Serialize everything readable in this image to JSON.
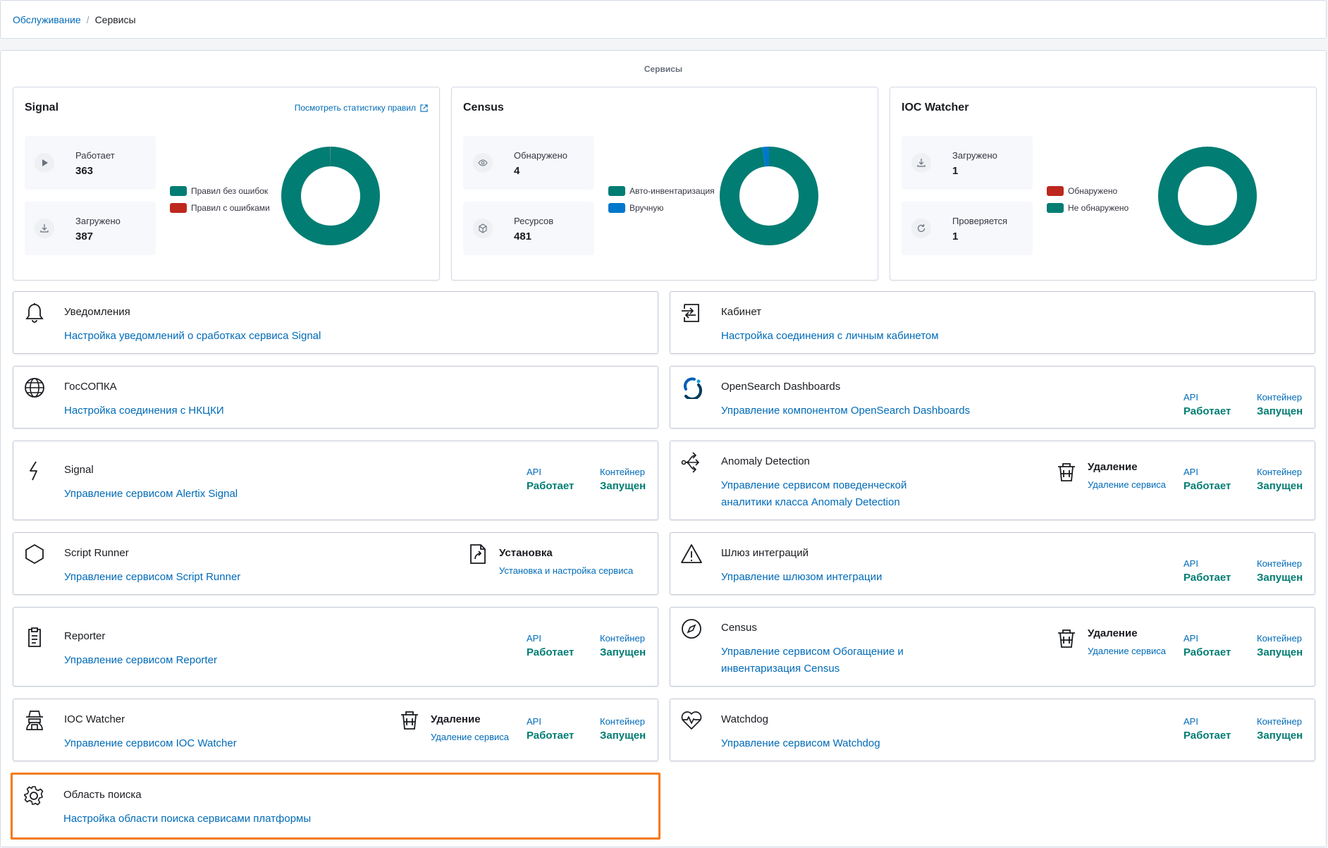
{
  "breadcrumb": {
    "parent": "Обслуживание",
    "separator": "/",
    "current": "Сервисы"
  },
  "panel_title": "Сервисы",
  "stat_cards": {
    "signal": {
      "title": "Signal",
      "link": "Посмотреть статистику правил",
      "metric1": {
        "label": "Работает",
        "value": "363",
        "icon": "play-icon"
      },
      "metric2": {
        "label": "Загружено",
        "value": "387",
        "icon": "download-icon"
      },
      "legend": [
        {
          "label": "Правил без ошибок",
          "color": "#017d73"
        },
        {
          "label": "Правил с ошибками",
          "color": "#bd271e"
        }
      ],
      "donut": [
        {
          "label": "Правил без ошибок",
          "value": 363,
          "color": "#017d73"
        },
        {
          "label": "Правил с ошибками",
          "value": 1,
          "color": "#6a717d"
        }
      ]
    },
    "census": {
      "title": "Census",
      "metric1": {
        "label": "Обнаружено",
        "value": "4",
        "icon": "eye-icon"
      },
      "metric2": {
        "label": "Ресурсов",
        "value": "481",
        "icon": "cube-icon"
      },
      "legend": [
        {
          "label": "Авто-инвентаризация",
          "color": "#017d73"
        },
        {
          "label": "Вручную",
          "color": "#0077cc"
        }
      ],
      "donut": [
        {
          "label": "Авто-инвентаризация",
          "value": 470,
          "color": "#017d73"
        },
        {
          "label": "Вручную",
          "value": 11,
          "color": "#0077cc"
        }
      ]
    },
    "ioc": {
      "title": "IOC Watcher",
      "metric1": {
        "label": "Загружено",
        "value": "1",
        "icon": "download-icon"
      },
      "metric2": {
        "label": "Проверяется",
        "value": "1",
        "icon": "refresh-icon"
      },
      "legend": [
        {
          "label": "Обнаружено",
          "color": "#bd271e"
        },
        {
          "label": "Не обнаружено",
          "color": "#017d73"
        }
      ],
      "donut": [
        {
          "label": "Не обнаружено",
          "value": 1,
          "color": "#017d73"
        }
      ]
    }
  },
  "status_labels": {
    "api": "API",
    "container": "Контейнер",
    "running": "Работает",
    "started": "Запущен"
  },
  "services": {
    "notifications": {
      "title": "Уведомления",
      "desc": "Настройка уведомлений о сработках сервиса Signal",
      "icon": "bell-icon"
    },
    "cabinet": {
      "title": "Кабинет",
      "desc": "Настройка соединения с личным кабинетом",
      "icon": "login-icon"
    },
    "gossopka": {
      "title": "ГосСОПКА",
      "desc": "Настройка соединения с НКЦКИ",
      "icon": "globe-icon"
    },
    "opensearch": {
      "title": "OpenSearch Dashboards",
      "desc": "Управление компонентом OpenSearch Dashboards",
      "icon": "opensearch-logo-icon"
    },
    "signal": {
      "title": "Signal",
      "desc": "Управление сервисом Alertix Signal",
      "icon": "lightning-icon"
    },
    "anomaly": {
      "title": "Anomaly Detection",
      "desc1": "Управление сервисом поведенческой",
      "desc2": "аналитики класса Anomaly Detection",
      "icon": "branch-arrows-icon",
      "action": {
        "title": "Удаление",
        "link": "Удаление сервиса",
        "icon": "trash-icon"
      }
    },
    "script_runner": {
      "title": "Script Runner",
      "desc": "Управление сервисом Script Runner",
      "icon": "hexagon-icon",
      "action": {
        "title": "Установка",
        "link": "Установка и настройка сервиса",
        "icon": "file-arrow-icon"
      }
    },
    "gateway": {
      "title": "Шлюз интеграций",
      "desc": "Управление шлюзом интеграции",
      "icon": "warning-icon"
    },
    "reporter": {
      "title": "Reporter",
      "desc": "Управление сервисом Reporter",
      "icon": "clipboard-icon"
    },
    "census": {
      "title": "Census",
      "desc1": "Управление сервисом Обогащение и",
      "desc2": "инвентаризация Census",
      "icon": "compass-icon",
      "action": {
        "title": "Удаление",
        "link": "Удаление сервиса",
        "icon": "trash-icon"
      }
    },
    "ioc_watcher": {
      "title": "IOC Watcher",
      "desc": "Управление сервисом IOC Watcher",
      "icon": "spy-icon",
      "action": {
        "title": "Удаление",
        "link": "Удаление сервиса",
        "icon": "trash-icon"
      }
    },
    "watchdog": {
      "title": "Watchdog",
      "desc": "Управление сервисом Watchdog",
      "icon": "heart-pulse-icon"
    },
    "search_scope": {
      "title": "Область поиска",
      "desc": "Настройка области поиска сервисами платформы",
      "icon": "gear-icon"
    }
  },
  "colors": {
    "accent": "#006bb8",
    "success": "#017d73",
    "danger": "#bd271e",
    "highlight": "#f57b18"
  }
}
